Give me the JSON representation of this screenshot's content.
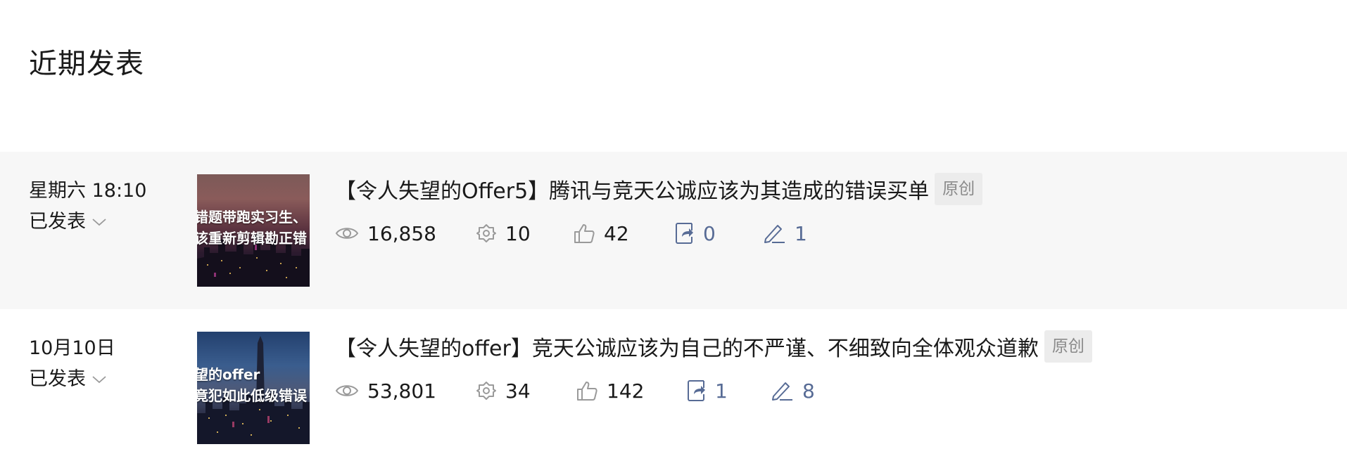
{
  "section_title": "近期发表",
  "articles": [
    {
      "date": "星期六 18:10",
      "status": "已发表",
      "thumb_lines": [
        "错题带跑实习生、",
        "该重新剪辑勘正错"
      ],
      "title": "【令人失望的Offer5】腾讯与竞天公诚应该为其造成的错误买单",
      "badge": "原创",
      "views": "16,858",
      "shares": "10",
      "likes": "42",
      "forwards": "0",
      "comments": "1"
    },
    {
      "date": "10月10日",
      "status": "已发表",
      "thumb_lines": [
        "望的offer",
        "竟犯如此低级错误"
      ],
      "title": "【令人失望的offer】竞天公诚应该为自己的不严谨、不细致向全体观众道歉",
      "badge": "原创",
      "views": "53,801",
      "shares": "34",
      "likes": "142",
      "forwards": "1",
      "comments": "8"
    }
  ],
  "colors": {
    "accent_blue": "#576b95",
    "row_highlight": "#f7f7f7",
    "icon_gray": "#9a9a9a",
    "badge_bg": "#ececec"
  },
  "icons": [
    "eye-icon",
    "share-gear-icon",
    "thumbs-up-icon",
    "forward-icon",
    "pen-icon",
    "chevron-down-icon"
  ]
}
